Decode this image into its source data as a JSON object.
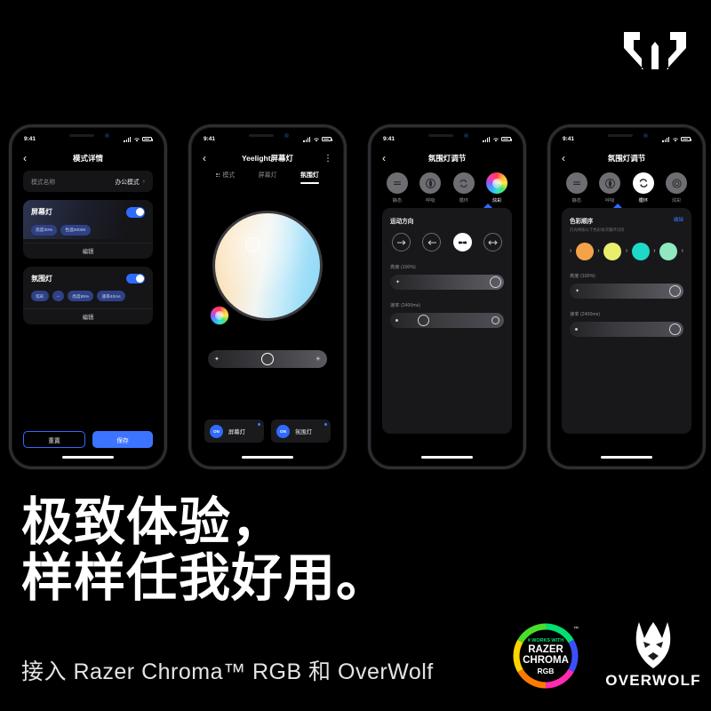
{
  "brand": {
    "logo": "yeelight-logo"
  },
  "headline": {
    "line1": "极致体验，",
    "line2": "样样任我好用。"
  },
  "subline": "接入 Razer Chroma™ RGB 和 OverWolf",
  "partners": {
    "razer": {
      "works_with": "WORKS WITH",
      "name": "RAZER",
      "chroma": "CHROMA",
      "rgb": "RGB",
      "tm": "™"
    },
    "overwolf": {
      "name": "OVERWOLF"
    }
  },
  "statusbar": {
    "time": "9:41"
  },
  "phone1": {
    "nav": {
      "back": "‹",
      "title": "模式详情"
    },
    "name_row": {
      "label": "模式名称",
      "value": "办公模式",
      "chevron": "›"
    },
    "devices": [
      {
        "name": "屏幕灯",
        "toggle": "on",
        "tags": [
          "亮度30%",
          "色温3000K"
        ],
        "edit": "编辑"
      },
      {
        "name": "氛围灯",
        "toggle": "on",
        "tags": [
          "炫彩",
          "→",
          "亮度85%",
          "速率40ms"
        ],
        "edit": "编辑"
      }
    ],
    "footer": {
      "reset": "重置",
      "save": "保存"
    }
  },
  "phone2": {
    "nav": {
      "back": "‹",
      "title": "Yeelight屏幕灯",
      "more": "⋮"
    },
    "tabs": [
      {
        "label": "模式",
        "icon": "grid-icon",
        "active": false
      },
      {
        "label": "屏幕灯",
        "active": false
      },
      {
        "label": "氛围灯",
        "active": true
      }
    ],
    "wheel": {
      "name": "color-temperature-wheel",
      "color_button": "rgb-color-picker"
    },
    "brightness_slider": {
      "low_icon": "dim-icon",
      "high_icon": "bright-icon"
    },
    "power_cards": [
      {
        "badge": "ON",
        "label": "屏幕灯"
      },
      {
        "badge": "ON",
        "label": "氛围灯"
      }
    ]
  },
  "phone3": {
    "nav": {
      "back": "‹",
      "title": "氛围灯调节"
    },
    "modes": [
      {
        "label": "静态",
        "icon": "static-icon",
        "active": false
      },
      {
        "label": "呼吸",
        "icon": "breathe-icon",
        "active": false
      },
      {
        "label": "循环",
        "icon": "cycle-icon",
        "active": false
      },
      {
        "label": "炫彩",
        "icon": "rainbow-icon",
        "active": true
      }
    ],
    "direction": {
      "title": "运动方向",
      "options": [
        {
          "icon": "arrow-right-icon",
          "glyph": "→",
          "active": false
        },
        {
          "icon": "arrow-left-icon",
          "glyph": "←",
          "active": false
        },
        {
          "icon": "converge-icon",
          "glyph": "→←",
          "active": true
        },
        {
          "icon": "diverge-icon",
          "glyph": "↔",
          "active": false
        }
      ]
    },
    "brightness": {
      "label": "亮度",
      "value": "(100%)"
    },
    "rate": {
      "label": "速率",
      "value": "(2400ms)"
    }
  },
  "phone4": {
    "nav": {
      "back": "‹",
      "title": "氛围灯调节"
    },
    "modes": [
      {
        "label": "静态",
        "icon": "static-icon",
        "active": false
      },
      {
        "label": "呼吸",
        "icon": "breathe-icon",
        "active": false
      },
      {
        "label": "循环",
        "icon": "cycle-icon",
        "active": true
      },
      {
        "label": "炫彩",
        "icon": "rainbow-icon",
        "active": false
      }
    ],
    "color_sequence": {
      "title": "色彩顺序",
      "subtitle": "灯光将按以下色彩依次循环闪烁",
      "edit": "编辑",
      "colors": [
        "#F5A34A",
        "#E8EF6C",
        "#1ED9C8",
        "#8FE8C0"
      ],
      "arrow": "›"
    },
    "brightness": {
      "label": "亮度",
      "value": "(100%)"
    },
    "rate": {
      "label": "速率",
      "value": "(2400ms)"
    }
  }
}
